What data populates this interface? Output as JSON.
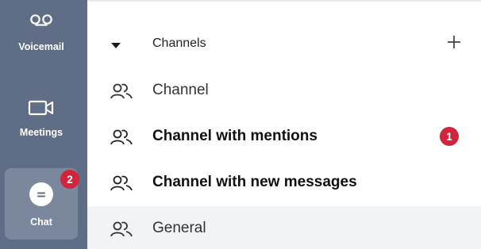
{
  "sidebar": {
    "items": [
      {
        "label": "Voicemail",
        "icon": "voicemail-icon"
      },
      {
        "label": "Meetings",
        "icon": "video-camera-icon"
      },
      {
        "label": "Chat",
        "icon": "chat-bubble-icon",
        "badge": "2",
        "active": true
      }
    ]
  },
  "channels": {
    "header": "Channels",
    "rows": [
      {
        "name": "Channel",
        "icon": "group-icon",
        "bold": false
      },
      {
        "name": "Channel with mentions",
        "icon": "group-icon",
        "bold": true,
        "badge": "1"
      },
      {
        "name": "Channel with new messages",
        "icon": "group-icon",
        "bold": true
      },
      {
        "name": "General",
        "icon": "group-icon",
        "bold": false,
        "selected": true
      }
    ]
  },
  "colors": {
    "sidebar_bg": "#5f6d86",
    "sidebar_active_bg": "#7b879c",
    "badge_red": "#d2243a",
    "selected_row_bg": "#f2f3f5"
  }
}
